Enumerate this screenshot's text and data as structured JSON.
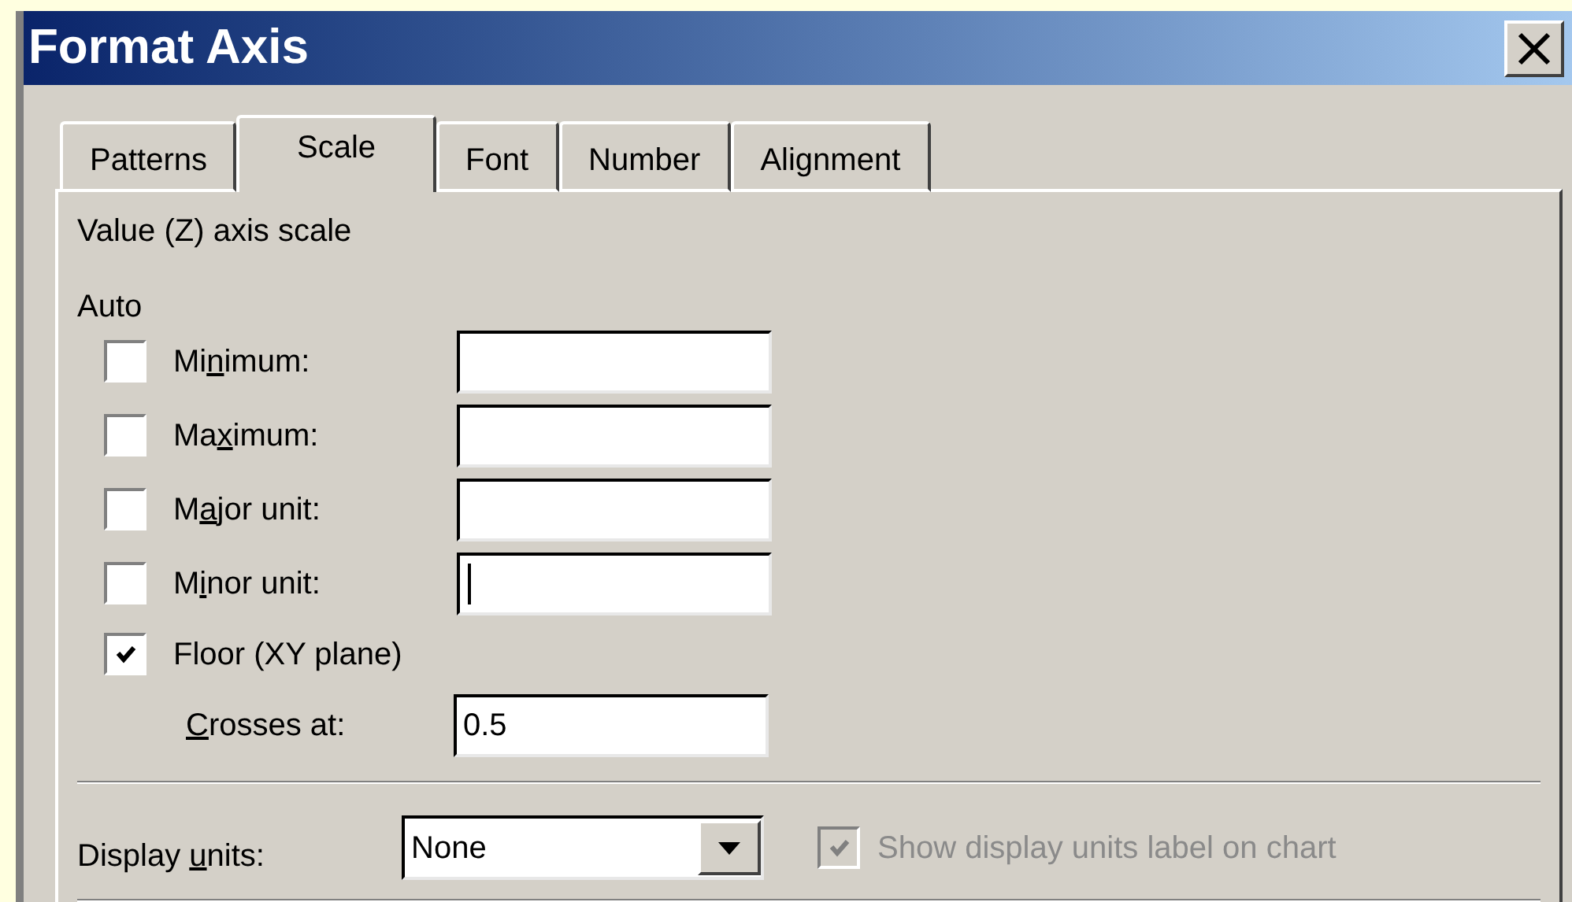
{
  "window": {
    "title": "Format Axis"
  },
  "tabs": [
    {
      "label": "Patterns",
      "selected": false
    },
    {
      "label": "Scale",
      "selected": true
    },
    {
      "label": "Font",
      "selected": false
    },
    {
      "label": "Number",
      "selected": false
    },
    {
      "label": "Alignment",
      "selected": false
    }
  ],
  "scale": {
    "heading": "Value (Z) axis scale",
    "group_label": "Auto",
    "rows": [
      {
        "kind": "auto_value",
        "label": {
          "pre": "Mi",
          "key": "n",
          "post": "imum:"
        },
        "checked": false,
        "focused": false
      },
      {
        "kind": "auto_value",
        "label": {
          "pre": "Ma",
          "key": "x",
          "post": "imum:"
        },
        "checked": false,
        "focused": false
      },
      {
        "kind": "auto_value",
        "label": {
          "pre": "M",
          "key": "a",
          "post": "jor unit:"
        },
        "checked": false,
        "focused": false
      },
      {
        "kind": "auto_value",
        "label": {
          "pre": "M",
          "key": "i",
          "post": "nor unit:"
        },
        "checked": false,
        "focused": true
      },
      {
        "kind": "checkbox",
        "label": {
          "pre": "Floor (XY plane)"
        },
        "checked": true
      },
      {
        "kind": "value",
        "label": {
          "key": "C",
          "post": "rosses at:"
        },
        "value": "0.5",
        "focused": false
      }
    ]
  },
  "display_units": {
    "label": {
      "pre": "Display ",
      "key": "u",
      "post": "nits:"
    },
    "value": "None"
  },
  "show_units_label": {
    "label": "Show display units label on chart",
    "checked": true,
    "disabled": true
  }
}
